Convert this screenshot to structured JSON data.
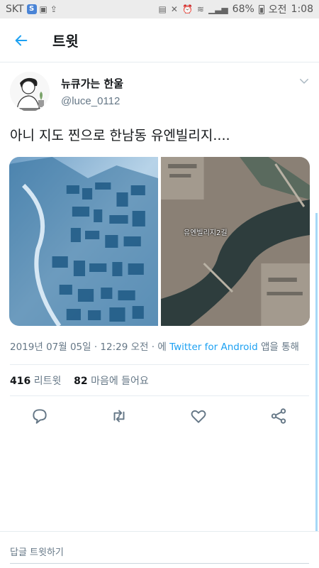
{
  "status_bar": {
    "carrier": "SKT",
    "carrier_badge": "S",
    "battery": "68%",
    "ampm": "오전",
    "time": "1:08"
  },
  "header": {
    "title": "트윗",
    "back_icon": "arrow-left-icon"
  },
  "tweet": {
    "author_name": "뉴큐가는 한울",
    "author_handle": "@luce_0112",
    "text": "아니 지도 찐으로 한남동 유엔빌리지....",
    "media": [
      {
        "icon": "city-map-image"
      },
      {
        "icon": "satellite-image",
        "label": "유엔빌리지2길"
      }
    ],
    "date": "2019년 07월 05일 · 12:29 오전 · 에",
    "client": "Twitter for Android",
    "client_suffix": "앱을 통해",
    "retweets_count": "416",
    "retweets_label": "리트윗",
    "likes_count": "82",
    "likes_label": "마음에 들어요"
  },
  "actions": {
    "reply_icon": "reply-icon",
    "retweet_icon": "retweet-icon",
    "like_icon": "heart-icon",
    "share_icon": "share-icon"
  },
  "reply_bar": {
    "placeholder": "답글 트윗하기"
  },
  "colors": {
    "accent": "#1da1f2",
    "secondary_text": "#657786",
    "divider": "#e6ecf0"
  }
}
